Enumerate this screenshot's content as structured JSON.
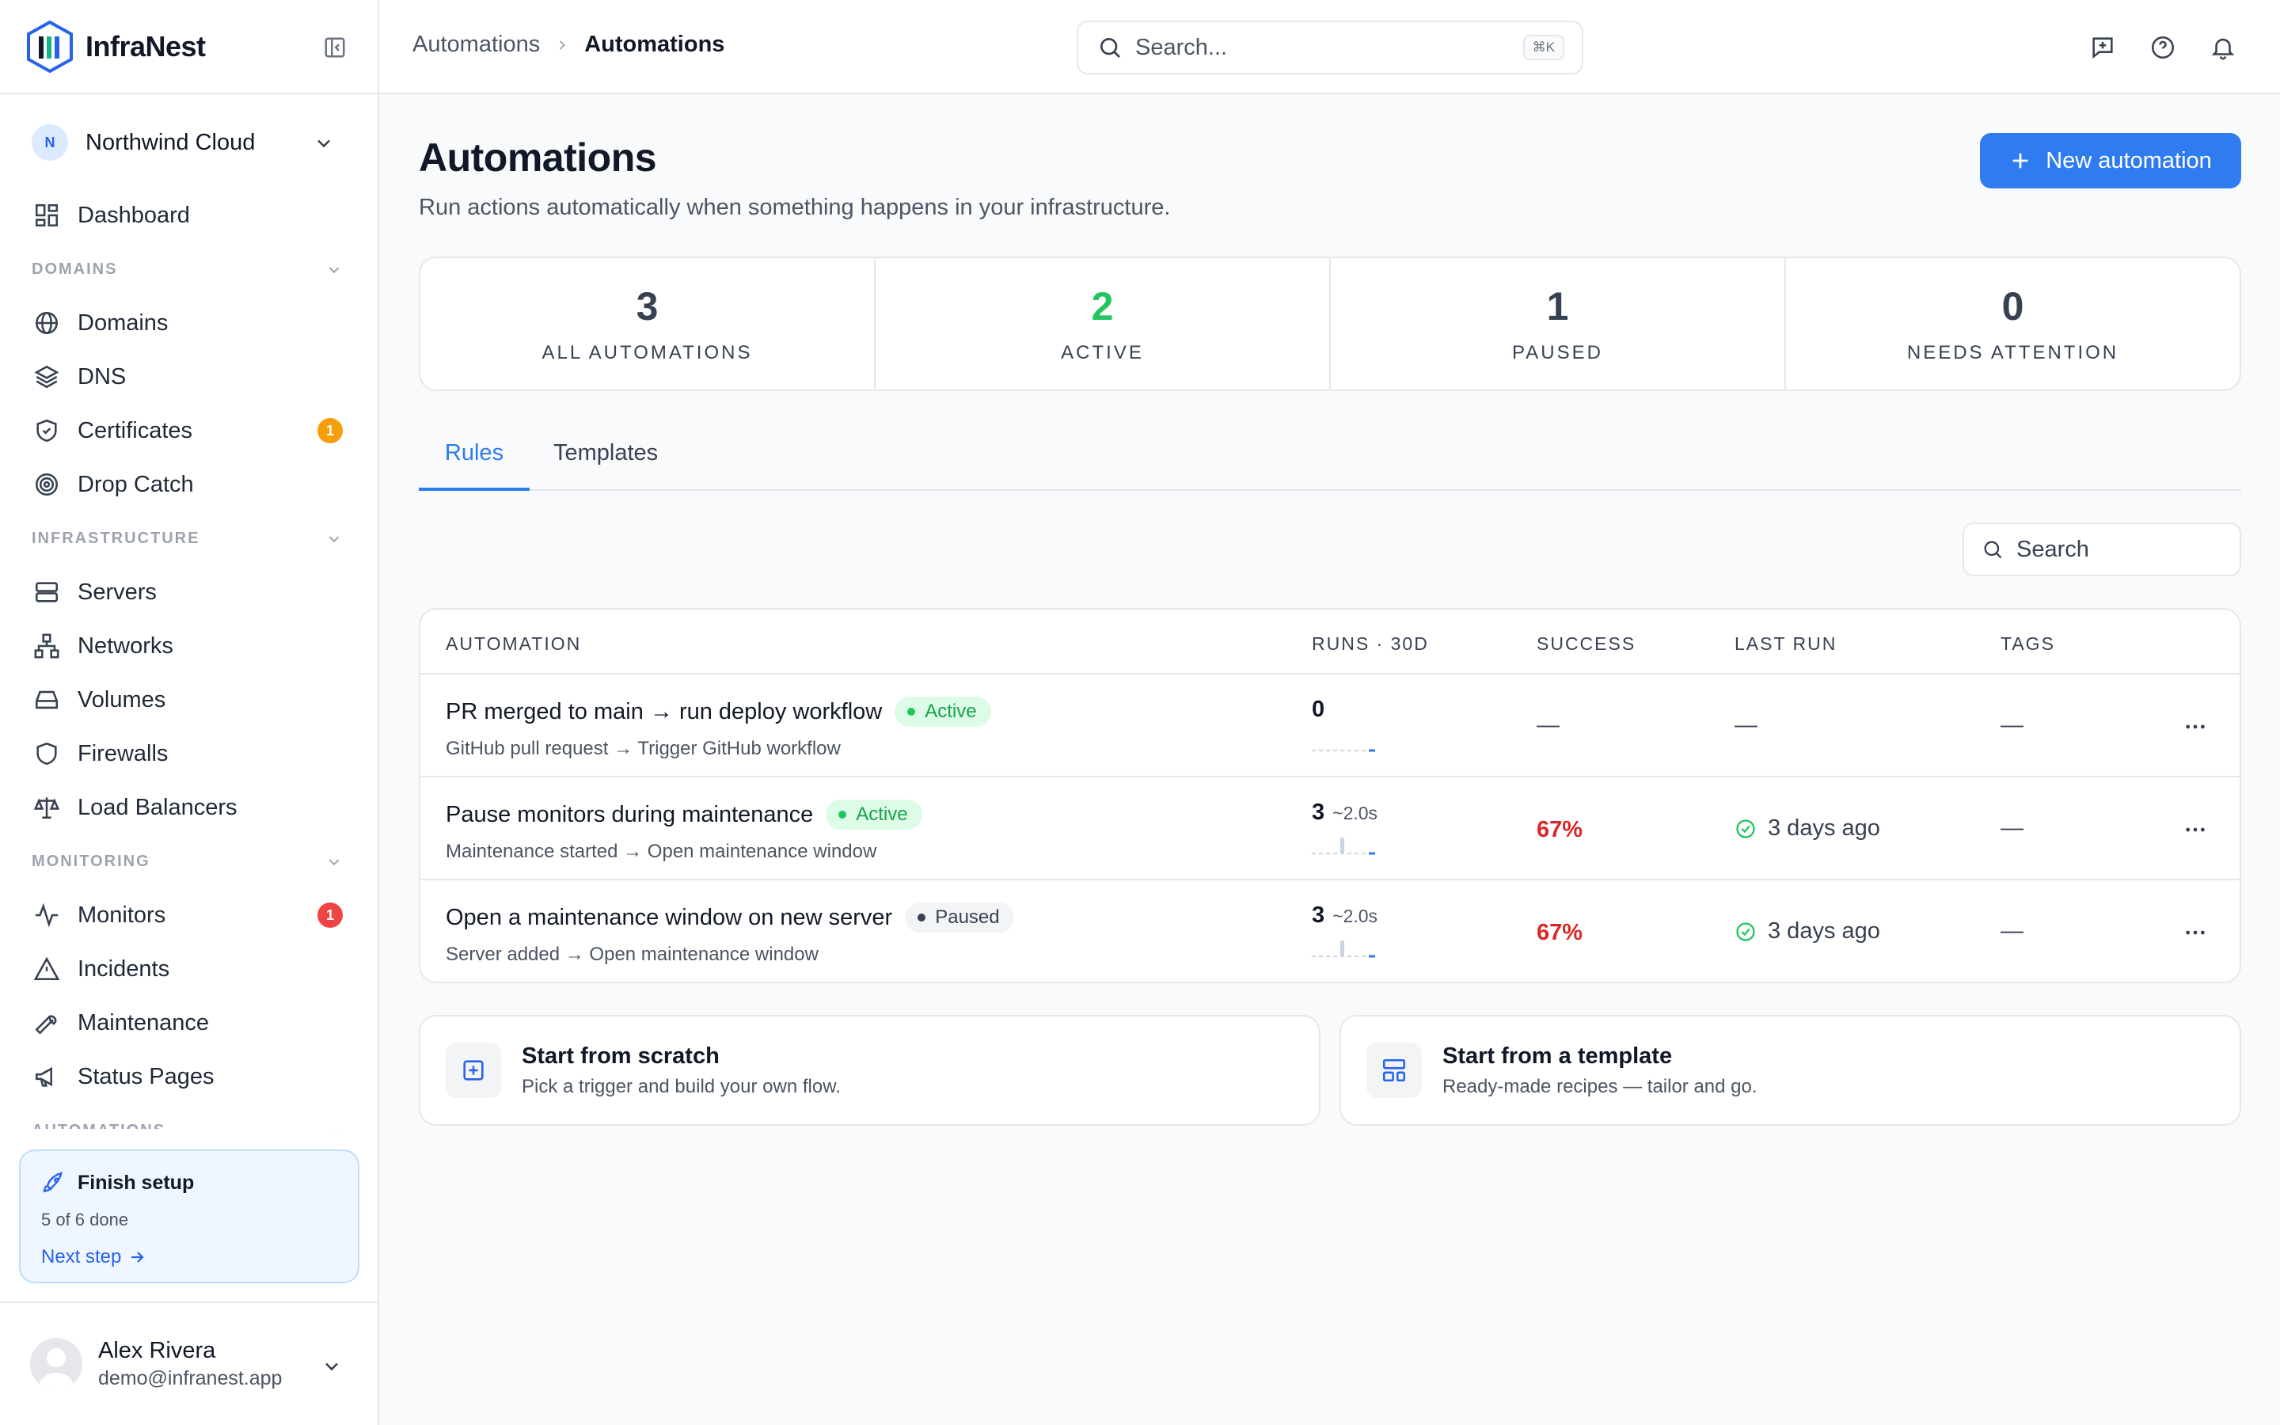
{
  "brand": {
    "name": "InfraNest"
  },
  "org": {
    "initial": "N",
    "name": "Northwind Cloud"
  },
  "nav": {
    "dashboard": "Dashboard",
    "sections": {
      "domains": "DOMAINS",
      "infrastructure": "INFRASTRUCTURE",
      "monitoring": "MONITORING",
      "automations": "AUTOMATIONS"
    },
    "domains": "Domains",
    "dns": "DNS",
    "certificates": "Certificates",
    "certificates_badge": "1",
    "drop_catch": "Drop Catch",
    "servers": "Servers",
    "networks": "Networks",
    "volumes": "Volumes",
    "firewalls": "Firewalls",
    "load_balancers": "Load Balancers",
    "monitors": "Monitors",
    "monitors_badge": "1",
    "incidents": "Incidents",
    "maintenance": "Maintenance",
    "status_pages": "Status Pages"
  },
  "setup": {
    "title": "Finish setup",
    "progress": "5 of 6 done",
    "next": "Next step"
  },
  "user": {
    "name": "Alex Rivera",
    "email": "demo@infranest.app"
  },
  "header": {
    "crumb_parent": "Automations",
    "crumb_current": "Automations",
    "search_placeholder": "Search...",
    "search_shortcut": "⌘K"
  },
  "page": {
    "title": "Automations",
    "subtitle": "Run actions automatically when something happens in your infrastructure.",
    "new_button": "New automation"
  },
  "stats": [
    {
      "value": "3",
      "label": "ALL AUTOMATIONS",
      "color": "#374151"
    },
    {
      "value": "2",
      "label": "ACTIVE",
      "color": "#22c55e"
    },
    {
      "value": "1",
      "label": "PAUSED",
      "color": "#374151"
    },
    {
      "value": "0",
      "label": "NEEDS ATTENTION",
      "color": "#374151"
    }
  ],
  "tabs": {
    "rules": "Rules",
    "templates": "Templates"
  },
  "table": {
    "search_placeholder": "Search",
    "columns": {
      "automation": "AUTOMATION",
      "runs": "RUNS · 30D",
      "success": "SUCCESS",
      "last_run": "LAST RUN",
      "tags": "TAGS"
    },
    "rows": [
      {
        "name": "PR merged to main → run deploy workflow",
        "status": "Active",
        "desc": "GitHub pull request → Trigger GitHub workflow",
        "runs": "0",
        "avg": "",
        "success": "—",
        "last_run": "—",
        "tags": "—"
      },
      {
        "name": "Pause monitors during maintenance",
        "status": "Active",
        "desc": "Maintenance started → Open maintenance window",
        "runs": "3",
        "avg": "~2.0s",
        "success": "67%",
        "last_run": "3 days ago",
        "tags": "—"
      },
      {
        "name": "Open a maintenance window on new server",
        "status": "Paused",
        "desc": "Server added → Open maintenance window",
        "runs": "3",
        "avg": "~2.0s",
        "success": "67%",
        "last_run": "3 days ago",
        "tags": "—"
      }
    ]
  },
  "cards": {
    "scratch_title": "Start from scratch",
    "scratch_sub": "Pick a trigger and build your own flow.",
    "template_title": "Start from a template",
    "template_sub": "Ready-made recipes — tailor and go."
  }
}
